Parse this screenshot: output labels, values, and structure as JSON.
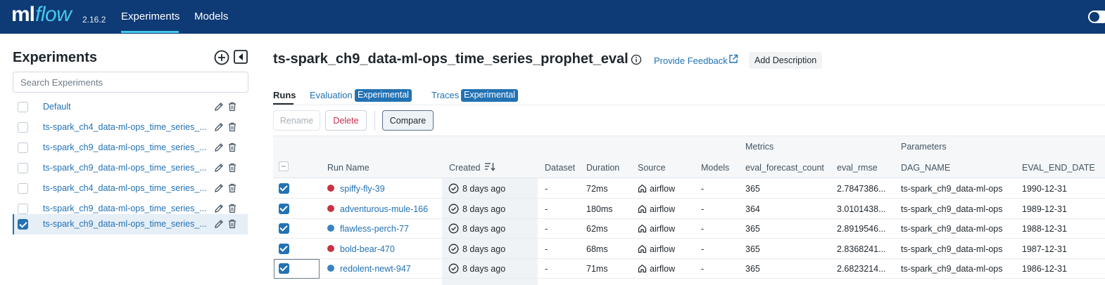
{
  "header": {
    "logo_ml": "ml",
    "logo_flow": "flow",
    "version": "2.16.2",
    "nav": [
      "Experiments",
      "Models"
    ],
    "colors": {
      "bg": "#0e3a75",
      "accent": "#43c9ed"
    }
  },
  "sidebar": {
    "title": "Experiments",
    "search_placeholder": "Search Experiments",
    "items": [
      {
        "label": "Default",
        "checked": false
      },
      {
        "label": "ts-spark_ch4_data-ml-ops_time_series_...",
        "checked": false
      },
      {
        "label": "ts-spark_ch9_data-ml-ops_time_series_...",
        "checked": false
      },
      {
        "label": "ts-spark_ch9_data-ml-ops_time_series_...",
        "checked": false
      },
      {
        "label": "ts-spark_ch4_data-ml-ops_time_series_...",
        "checked": false
      },
      {
        "label": "ts-spark_ch9_data-ml-ops_time_series_...",
        "checked": false
      },
      {
        "label": "ts-spark_ch9_data-ml-ops_time_series_...",
        "checked": true
      }
    ]
  },
  "main": {
    "title": "ts-spark_ch9_data-ml-ops_time_series_prophet_eval",
    "feedback": "Provide Feedback",
    "add_description": "Add Description",
    "tabs": {
      "runs": "Runs",
      "evaluation": "Evaluation",
      "evaluation_badge": "Experimental",
      "traces": "Traces",
      "traces_badge": "Experimental"
    },
    "buttons": {
      "rename": "Rename",
      "delete": "Delete",
      "compare": "Compare"
    }
  },
  "table": {
    "groups": {
      "metrics": "Metrics",
      "parameters": "Parameters"
    },
    "columns": {
      "run_name": "Run Name",
      "created": "Created",
      "dataset": "Dataset",
      "duration": "Duration",
      "source": "Source",
      "models": "Models",
      "eval_forecast_count": "eval_forecast_count",
      "eval_rmse": "eval_rmse",
      "dag_name": "DAG_NAME",
      "eval_end_date": "EVAL_END_DATE"
    },
    "rows": [
      {
        "name": "spiffy-fly-39",
        "color": "#c83243",
        "created": "8 days ago",
        "dataset": "-",
        "duration": "72ms",
        "source": "airflow",
        "models": "-",
        "count": "365",
        "rmse": "2.7847386...",
        "dag": "ts-spark_ch9_data-ml-ops",
        "end_date": "1990-12-31"
      },
      {
        "name": "adventurous-mule-166",
        "color": "#c83243",
        "created": "8 days ago",
        "dataset": "-",
        "duration": "180ms",
        "source": "airflow",
        "models": "-",
        "count": "364",
        "rmse": "3.0101438...",
        "dag": "ts-spark_ch9_data-ml-ops",
        "end_date": "1989-12-31"
      },
      {
        "name": "flawless-perch-77",
        "color": "#3b82c4",
        "created": "8 days ago",
        "dataset": "-",
        "duration": "62ms",
        "source": "airflow",
        "models": "-",
        "count": "365",
        "rmse": "2.8919546...",
        "dag": "ts-spark_ch9_data-ml-ops",
        "end_date": "1988-12-31"
      },
      {
        "name": "bold-bear-470",
        "color": "#c83243",
        "created": "8 days ago",
        "dataset": "-",
        "duration": "68ms",
        "source": "airflow",
        "models": "-",
        "count": "365",
        "rmse": "2.8368241...",
        "dag": "ts-spark_ch9_data-ml-ops",
        "end_date": "1987-12-31"
      },
      {
        "name": "redolent-newt-947",
        "color": "#3b82c4",
        "created": "8 days ago",
        "dataset": "-",
        "duration": "71ms",
        "source": "airflow",
        "models": "-",
        "count": "365",
        "rmse": "2.6823214...",
        "dag": "ts-spark_ch9_data-ml-ops",
        "end_date": "1986-12-31"
      }
    ]
  }
}
